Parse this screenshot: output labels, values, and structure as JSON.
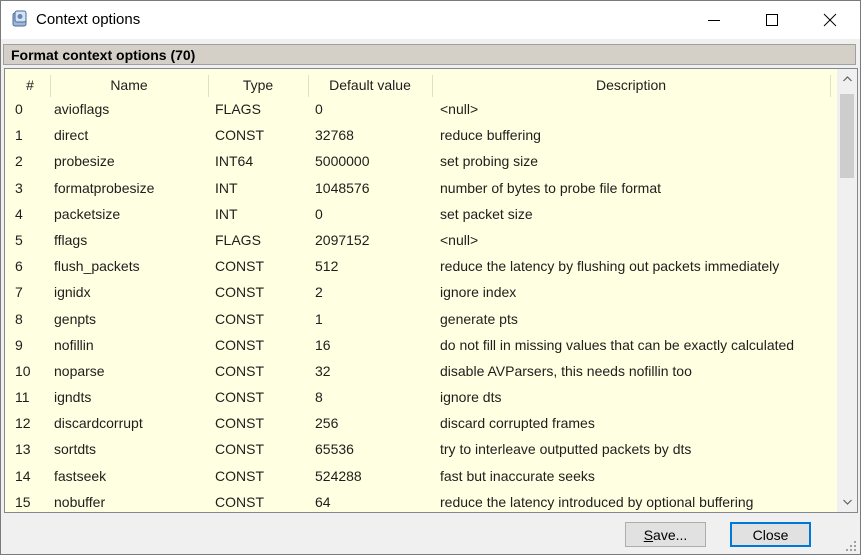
{
  "window": {
    "title": "Context options",
    "icon": "dialog-app-icon",
    "controls": [
      "minimize-icon",
      "maximize-icon",
      "close-icon"
    ]
  },
  "section": {
    "header": "Format context options (70)"
  },
  "table": {
    "columns": [
      "#",
      "Name",
      "Type",
      "Default value",
      "Description"
    ],
    "rows": [
      [
        "0",
        "avioflags",
        "FLAGS",
        "0",
        "<null>"
      ],
      [
        "1",
        "direct",
        "CONST",
        "32768",
        "reduce buffering"
      ],
      [
        "2",
        "probesize",
        "INT64",
        "5000000",
        "set probing size"
      ],
      [
        "3",
        "formatprobesize",
        "INT",
        "1048576",
        "number of bytes to probe file format"
      ],
      [
        "4",
        "packetsize",
        "INT",
        "0",
        "set packet size"
      ],
      [
        "5",
        "fflags",
        "FLAGS",
        "2097152",
        "<null>"
      ],
      [
        "6",
        "flush_packets",
        "CONST",
        "512",
        "reduce the latency by flushing out packets immediately"
      ],
      [
        "7",
        "ignidx",
        "CONST",
        "2",
        "ignore index"
      ],
      [
        "8",
        "genpts",
        "CONST",
        "1",
        "generate pts"
      ],
      [
        "9",
        "nofillin",
        "CONST",
        "16",
        "do not fill in missing values that can be exactly calculated"
      ],
      [
        "10",
        "noparse",
        "CONST",
        "32",
        "disable AVParsers, this needs nofillin too"
      ],
      [
        "11",
        "igndts",
        "CONST",
        "8",
        "ignore dts"
      ],
      [
        "12",
        "discardcorrupt",
        "CONST",
        "256",
        "discard corrupted frames"
      ],
      [
        "13",
        "sortdts",
        "CONST",
        "65536",
        "try to interleave outputted packets by dts"
      ],
      [
        "14",
        "fastseek",
        "CONST",
        "524288",
        "fast but inaccurate seeks"
      ],
      [
        "15",
        "nobuffer",
        "CONST",
        "64",
        "reduce the latency introduced by optional buffering"
      ]
    ]
  },
  "buttons": {
    "save_prefix": "S",
    "save_rest": "ave...",
    "close": "Close"
  },
  "colors": {
    "table_background": "#ffffe1",
    "header_bar": "#d4d0c8",
    "default_button_border": "#0078d7"
  }
}
